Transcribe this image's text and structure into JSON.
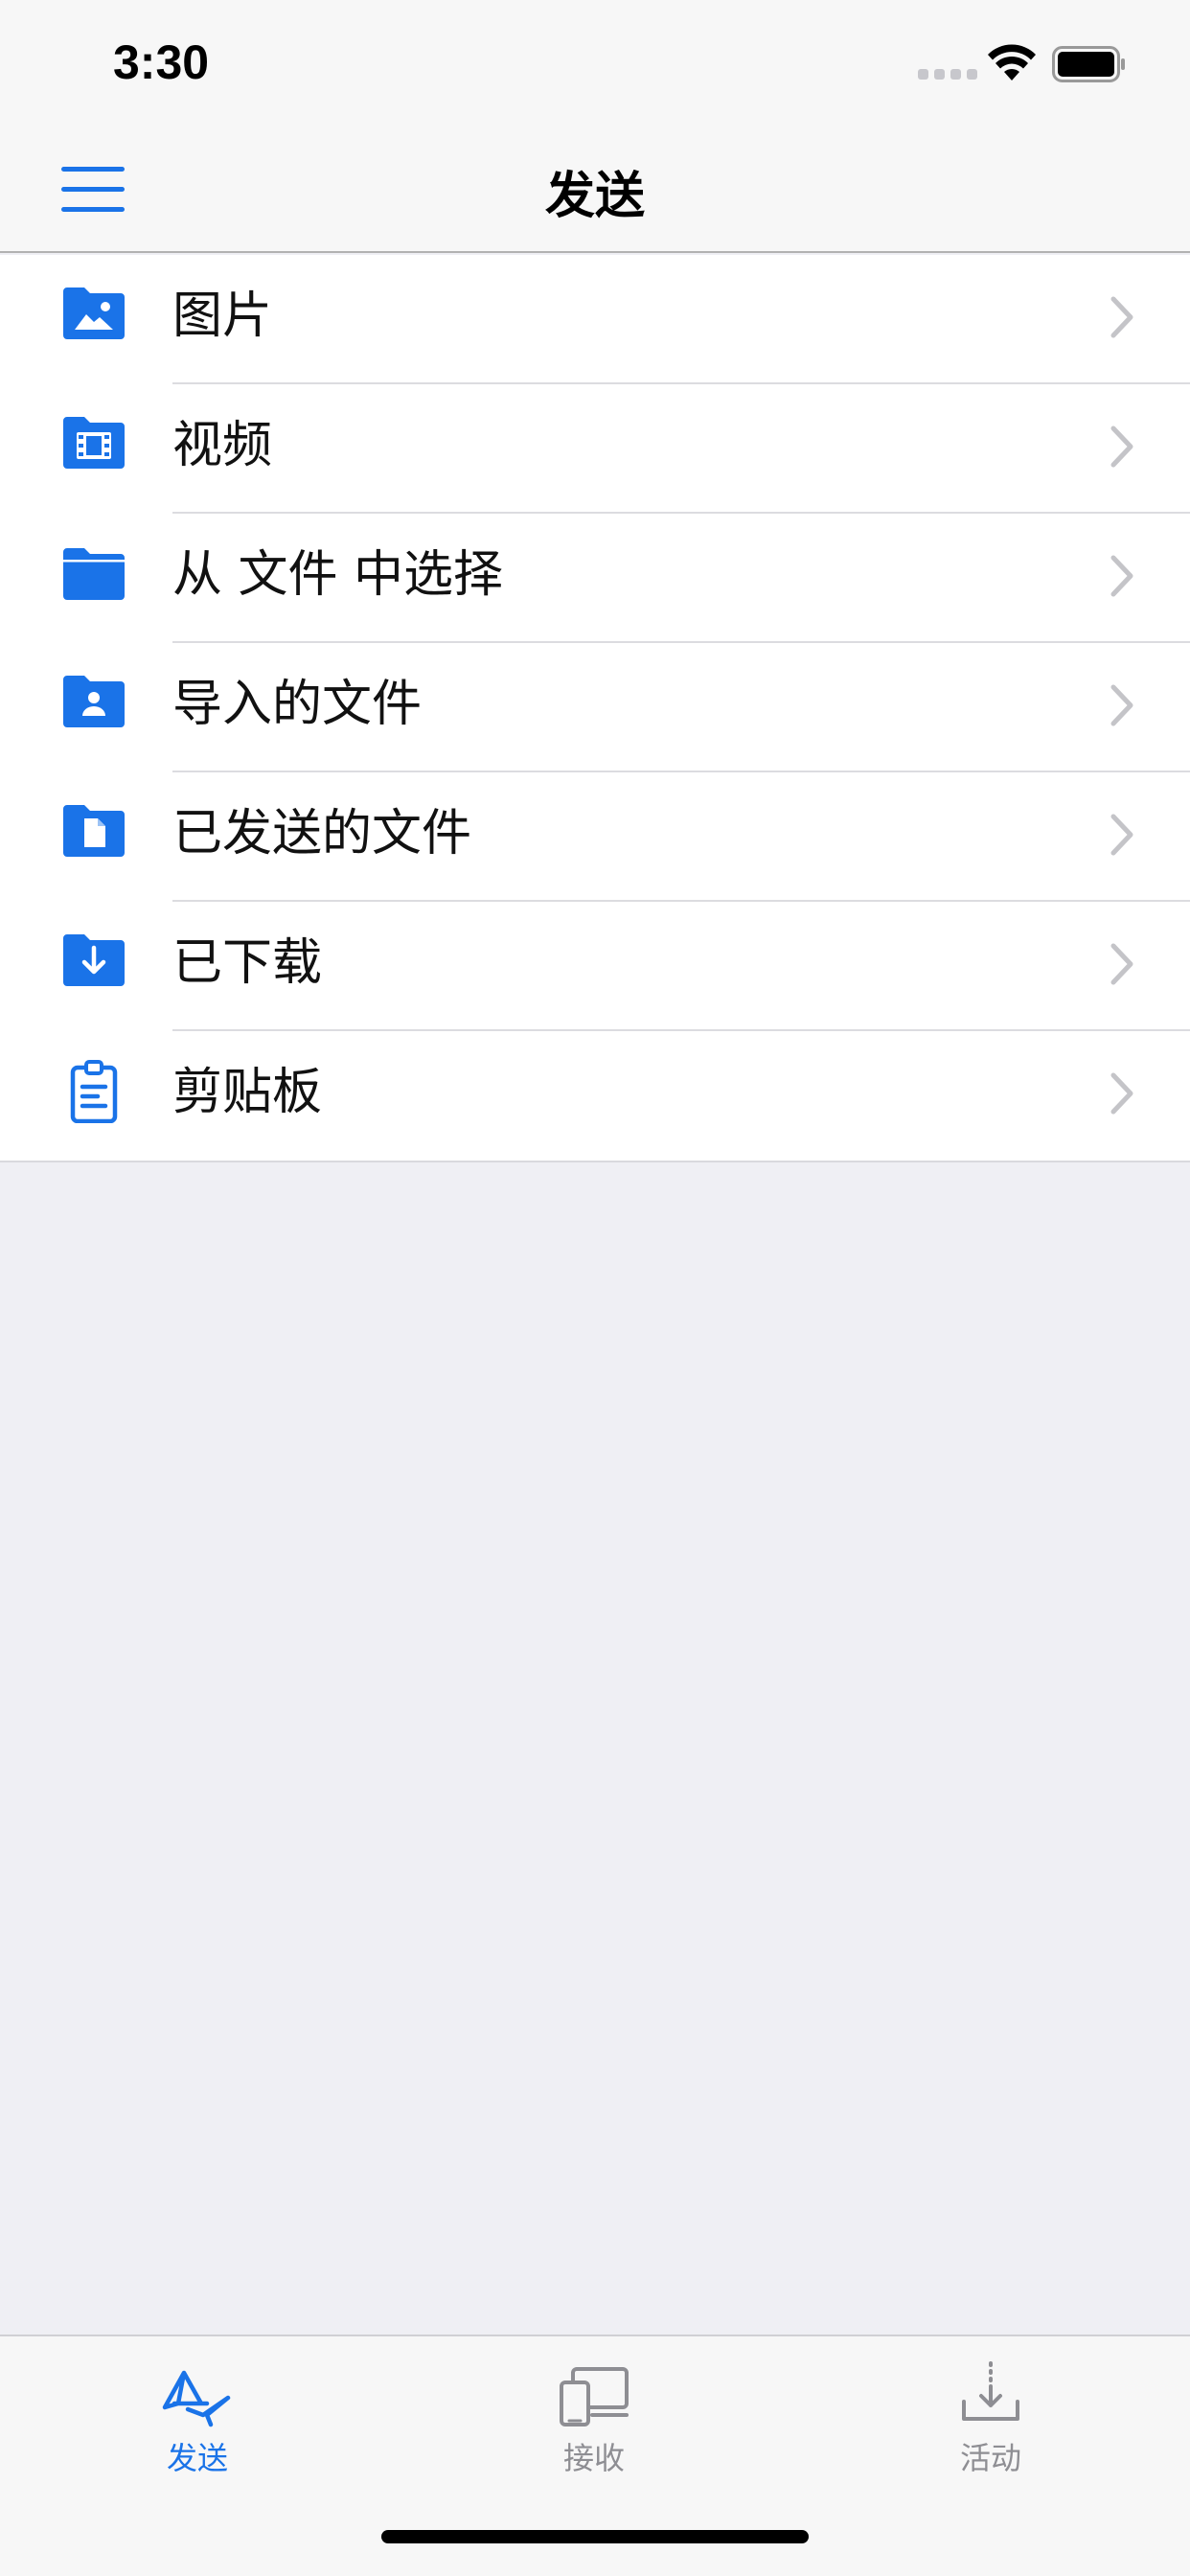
{
  "status_bar": {
    "time": "3:30"
  },
  "nav": {
    "title": "发送"
  },
  "list": [
    {
      "label": "图片",
      "icon": "folder-image-icon"
    },
    {
      "label": "视频",
      "icon": "folder-video-icon"
    },
    {
      "label": "从 文件 中选择",
      "icon": "folder-icon"
    },
    {
      "label": "导入的文件",
      "icon": "folder-person-icon"
    },
    {
      "label": "已发送的文件",
      "icon": "folder-document-icon"
    },
    {
      "label": "已下载",
      "icon": "folder-download-icon"
    },
    {
      "label": "剪贴板",
      "icon": "clipboard-icon"
    }
  ],
  "tabs": [
    {
      "label": "发送",
      "icon": "send-icon",
      "active": true
    },
    {
      "label": "接收",
      "icon": "devices-icon",
      "active": false
    },
    {
      "label": "活动",
      "icon": "download-tray-icon",
      "active": false
    }
  ],
  "colors": {
    "accent": "#1a73e8",
    "inactive": "#8e8e93",
    "background": "#efeff4"
  }
}
